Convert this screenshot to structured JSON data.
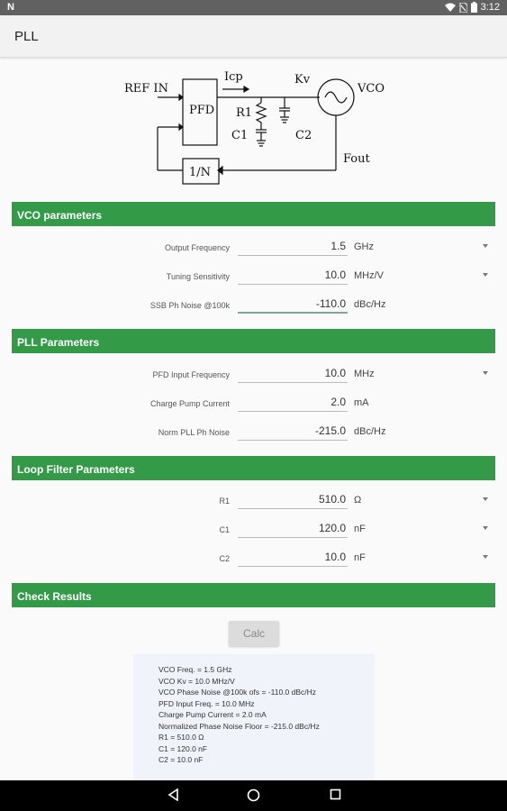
{
  "status_bar": {
    "notification_icon": "N",
    "time": "3:12"
  },
  "app_bar": {
    "title": "PLL"
  },
  "diagram": {
    "ref_in": "REF IN",
    "pfd": "PFD",
    "icp": "Icp",
    "kv": "Kv",
    "vco": "VCO",
    "r1": "R1",
    "c1": "C1",
    "c2": "C2",
    "fout": "Fout",
    "divider": "1/N"
  },
  "vco_section": {
    "title": "VCO parameters",
    "rows": [
      {
        "label": "Output Frequency",
        "value": "1.5",
        "unit": "GHz"
      },
      {
        "label": "Tuning Sensitivity",
        "value": "10.0",
        "unit": "MHz/V"
      },
      {
        "label": "SSB Ph Noise @100k",
        "value": "-110.0",
        "unit": "dBc/Hz"
      }
    ]
  },
  "pll_section": {
    "title": "PLL Parameters",
    "rows": [
      {
        "label": "PFD Input Frequency",
        "value": "10.0",
        "unit": "MHz"
      },
      {
        "label": "Charge Pump Current",
        "value": "2.0",
        "unit": "mA"
      },
      {
        "label": "Norm PLL Ph Noise",
        "value": "-215.0",
        "unit": "dBc/Hz"
      }
    ]
  },
  "loop_section": {
    "title": "Loop Filter Parameters",
    "rows": [
      {
        "label": "R1",
        "value": "510.0",
        "unit": "Ω"
      },
      {
        "label": "C1",
        "value": "120.0",
        "unit": "nF"
      },
      {
        "label": "C2",
        "value": "10.0",
        "unit": "nF"
      }
    ]
  },
  "check_section": {
    "title": "Check Results"
  },
  "calc_button": {
    "label": "Calc"
  },
  "results": [
    "VCO Freq. = 1.5 GHz",
    "VCO Kv = 10.0 MHz/V",
    "VCO Phase Noise @100k ofs = -110.0 dBc/Hz",
    "PFD Input Freq. = 10.0 MHz",
    "Charge Pump Current = 2.0 mA",
    "Normalized Phase Noise Floor = -215.0 dBc/Hz",
    "R1 = 510.0 Ω",
    "C1 = 120.0 nF",
    "C2 = 10.0 nF"
  ]
}
